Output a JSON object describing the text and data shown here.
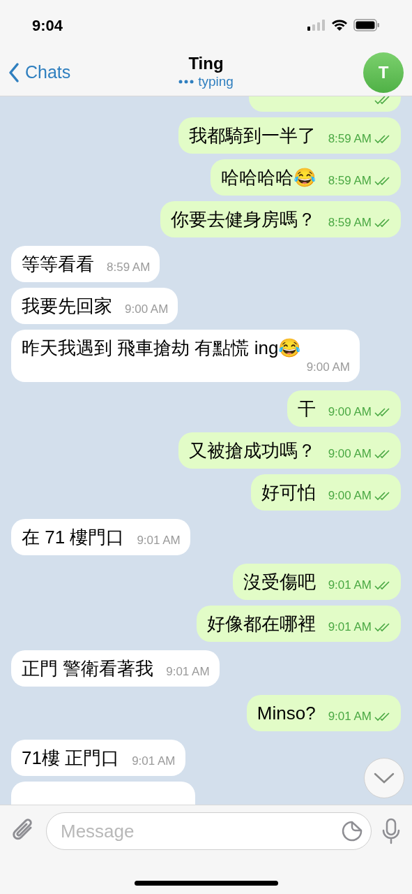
{
  "status_bar": {
    "time": "9:04"
  },
  "header": {
    "back_label": "Chats",
    "title": "Ting",
    "subtitle": "typing",
    "avatar_letter": "T"
  },
  "messages": [
    {
      "kind": "out",
      "read": true
    },
    {
      "kind": "out",
      "text": "我都騎到一半了",
      "time": "8:59 AM",
      "read": true
    },
    {
      "kind": "out",
      "text": "哈哈哈哈😂",
      "time": "8:59 AM",
      "read": true
    },
    {
      "kind": "out",
      "text": "你要去健身房嗎？",
      "time": "8:59 AM",
      "read": true
    },
    {
      "kind": "in",
      "text": "等等看看",
      "time": "8:59 AM"
    },
    {
      "kind": "in",
      "text": "我要先回家",
      "time": "9:00 AM"
    },
    {
      "kind": "in",
      "text": "昨天我遇到 飛車搶劫 有點慌 ing😂",
      "time": "9:00 AM"
    },
    {
      "kind": "out",
      "text": "干",
      "time": "9:00 AM",
      "read": true
    },
    {
      "kind": "out",
      "text": "又被搶成功嗎？",
      "time": "9:00 AM",
      "read": true
    },
    {
      "kind": "out",
      "text": "好可怕",
      "time": "9:00 AM",
      "read": true
    },
    {
      "kind": "in",
      "text": "在 71 樓門口",
      "time": "9:01 AM"
    },
    {
      "kind": "out",
      "text": "沒受傷吧",
      "time": "9:01 AM",
      "read": true
    },
    {
      "kind": "out",
      "text": "好像都在哪裡",
      "time": "9:01 AM",
      "read": true
    },
    {
      "kind": "in",
      "text": "正門 警衛看著我",
      "time": "9:01 AM"
    },
    {
      "kind": "out",
      "text": "Minso?",
      "time": "9:01 AM",
      "read": true
    },
    {
      "kind": "in",
      "text": "71樓 正門口",
      "time": "9:01 AM"
    },
    {
      "kind": "in"
    }
  ],
  "composer": {
    "placeholder": "Message"
  }
}
